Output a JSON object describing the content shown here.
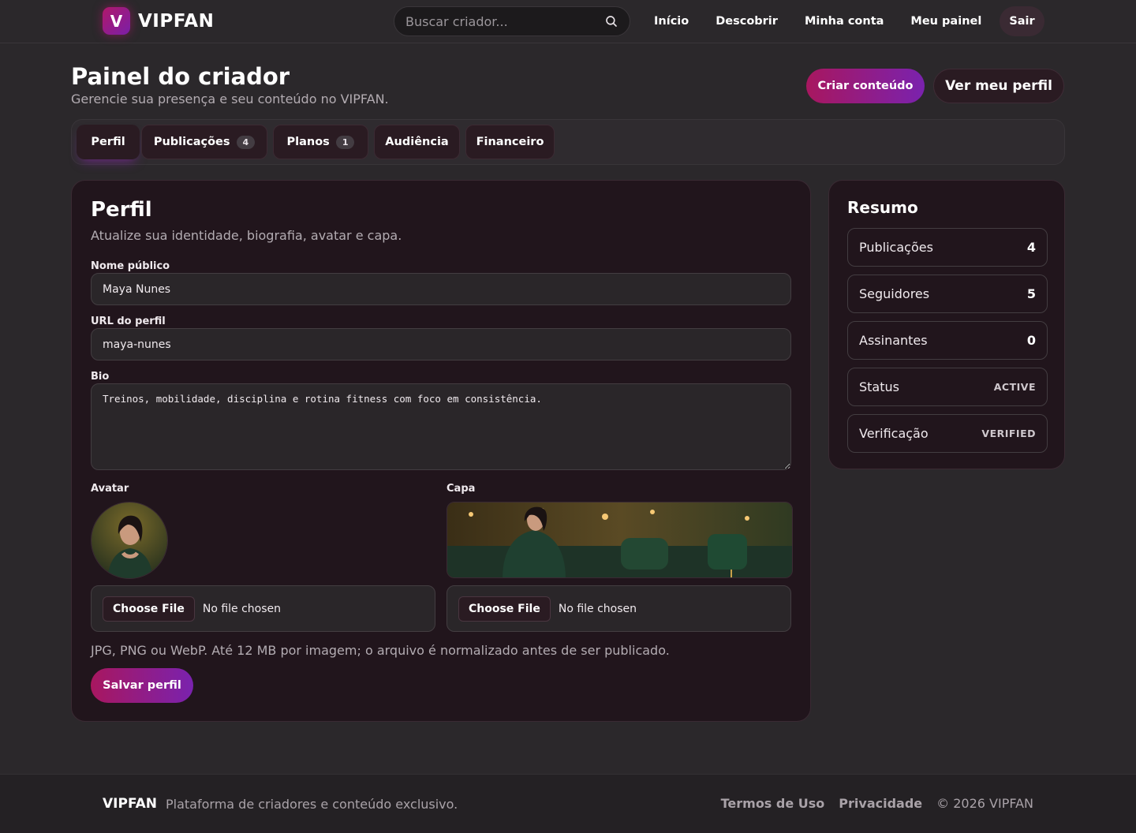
{
  "brand": {
    "mark": "V",
    "name": "VIPFAN"
  },
  "search": {
    "placeholder": "Buscar criador..."
  },
  "nav": [
    "Início",
    "Descobrir",
    "Minha conta",
    "Meu painel",
    "Sair"
  ],
  "page": {
    "title": "Painel do criador",
    "subtitle": "Gerencie sua presença e seu conteúdo no VIPFAN.",
    "primary_action": "Criar conteúdo",
    "secondary_action": "Ver meu perfil"
  },
  "tabs": [
    {
      "label": "Perfil",
      "badge": null,
      "active": true
    },
    {
      "label": "Publicações",
      "badge": "4"
    },
    {
      "label": "Planos",
      "badge": "1"
    },
    {
      "label": "Audiência",
      "badge": null
    },
    {
      "label": "Financeiro",
      "badge": null
    }
  ],
  "profile": {
    "title": "Perfil",
    "subtitle": "Atualize sua identidade, biografia, avatar e capa.",
    "name_label": "Nome público",
    "name_value": "Maya Nunes",
    "url_label": "URL do perfil",
    "url_value": "maya-nunes",
    "bio_label": "Bio",
    "bio_value": "Treinos, mobilidade, disciplina e rotina fitness com foco em consistência.",
    "avatar_label": "Avatar",
    "cover_label": "Capa",
    "file_button": "Choose File",
    "file_status": "No file chosen",
    "hint": "JPG, PNG ou WebP. Até 12 MB por imagem; o arquivo é normalizado antes de ser publicado.",
    "save": "Salvar perfil"
  },
  "summary": {
    "title": "Resumo",
    "rows": [
      {
        "label": "Publicações",
        "value": "4"
      },
      {
        "label": "Seguidores",
        "value": "5"
      },
      {
        "label": "Assinantes",
        "value": "0"
      },
      {
        "label": "Status",
        "value": "ACTIVE"
      },
      {
        "label": "Verificação",
        "value": "VERIFIED"
      }
    ]
  },
  "footer": {
    "brand": "VIPFAN",
    "tagline": "Plataforma de criadores e conteúdo exclusivo.",
    "terms": "Termos de Uso",
    "privacy": "Privacidade",
    "copyright": "© 2026 VIPFAN"
  },
  "colors": {
    "accent_start": "#a8175f",
    "accent_end": "#7a22ae",
    "card_bg": "#21151c"
  }
}
